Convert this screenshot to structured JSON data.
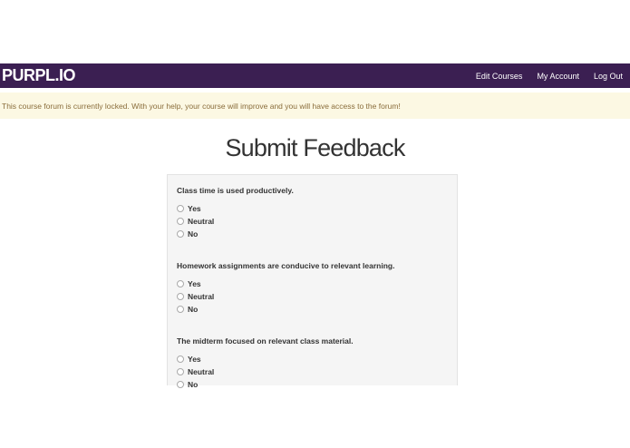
{
  "navbar": {
    "brand": "PURPL.IO",
    "links": [
      "Edit Courses",
      "My Account",
      "Log Out"
    ]
  },
  "alert": {
    "text": "This course forum is currently locked. With your help, your course will improve and you will have access to the forum!"
  },
  "page": {
    "title": "Submit Feedback"
  },
  "questions": [
    {
      "label": "Class time is used productively.",
      "options": [
        "Yes",
        "Neutral",
        "No"
      ]
    },
    {
      "label": "Homework assignments are conducive to relevant learning.",
      "options": [
        "Yes",
        "Neutral",
        "No"
      ]
    },
    {
      "label": "The midterm focused on relevant class material.",
      "options": [
        "Yes",
        "Neutral",
        "No"
      ]
    }
  ],
  "colors": {
    "navbar_bg": "#3b1f52",
    "alert_bg": "#fcf8e3",
    "alert_text": "#8a6d3b",
    "panel_bg": "#f5f5f5"
  }
}
